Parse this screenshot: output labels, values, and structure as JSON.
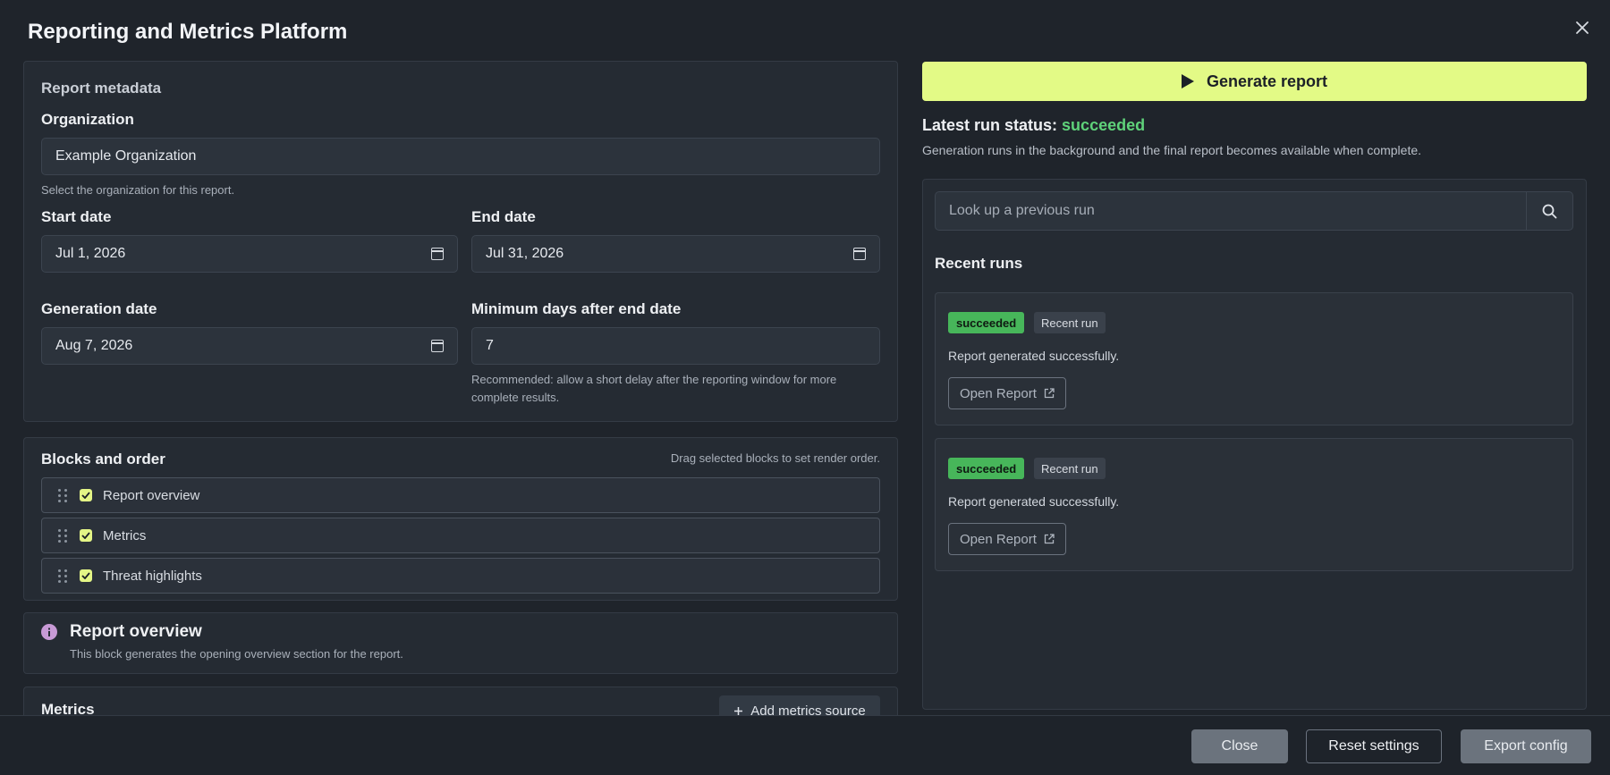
{
  "app": {
    "title": "Reporting and Metrics Platform"
  },
  "metadata": {
    "section_title": "Report metadata",
    "organization": {
      "label": "Organization",
      "value": "Example Organization",
      "help": "Select the organization for this report."
    },
    "start_date": {
      "label": "Start date",
      "value": "Jul 1, 2026"
    },
    "end_date": {
      "label": "End date",
      "value": "Jul 31, 2026"
    },
    "generation_date": {
      "label": "Generation date",
      "value": "Aug 7, 2026"
    },
    "min_days": {
      "label": "Minimum days after end date",
      "value": "7",
      "help": "Recommended: allow a short delay after the reporting window for more complete results."
    }
  },
  "blocks": {
    "title": "Blocks and order",
    "hint": "Drag selected blocks to set render order.",
    "items": [
      {
        "label": "Report overview",
        "checked": true
      },
      {
        "label": "Metrics",
        "checked": true
      },
      {
        "label": "Threat highlights",
        "checked": true
      }
    ]
  },
  "overview_info": {
    "title": "Report overview",
    "description": "This block generates the opening overview section for the report."
  },
  "metrics_section": {
    "title": "Metrics",
    "add_button": "Add metrics source"
  },
  "generate": {
    "button_label": "Generate report",
    "status_prefix": "Latest run status:",
    "status_value": "succeeded",
    "status_note": "Generation runs in the background and the final report becomes available when complete."
  },
  "runs": {
    "search_placeholder": "Look up a previous run",
    "title": "Recent runs",
    "items": [
      {
        "status": "succeeded",
        "tag": "Recent run",
        "message": "Report generated successfully.",
        "open_label": "Open Report"
      },
      {
        "status": "succeeded",
        "tag": "Recent run",
        "message": "Report generated successfully.",
        "open_label": "Open Report"
      }
    ]
  },
  "footer": {
    "close_label": "Close",
    "reset_label": "Reset settings",
    "export_label": "Export config"
  },
  "colors": {
    "accent": "#e3fa86",
    "success": "#47b65a",
    "background": "#1f242b"
  },
  "icons": [
    "close-icon",
    "calendar-icon",
    "drag-handle-icon",
    "checkbox-icon",
    "info-icon",
    "play-icon",
    "search-icon",
    "external-link-icon",
    "plus-icon"
  ]
}
